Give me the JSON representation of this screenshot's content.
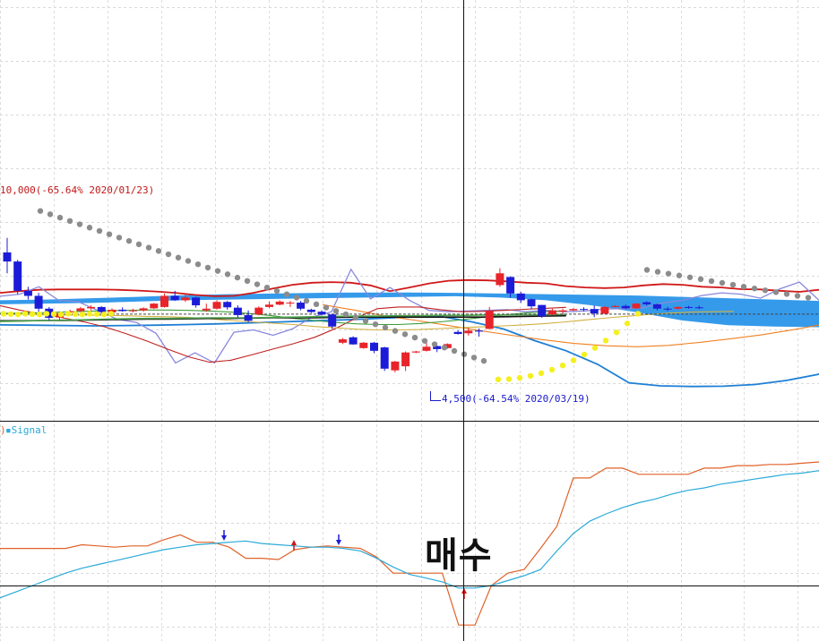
{
  "chart_data": [
    {
      "type": "candlestick",
      "pane": "price",
      "annotations": {
        "high": "10,000(-65.64% 2020/01/23)",
        "low": "4,500(-64.54% 2020/03/19)"
      },
      "colors": {
        "up": "#e8242a",
        "down": "#1c1cd8",
        "cloud": "#1f8fe8",
        "sar": "#8c8c8c",
        "sar_up": "#f4f020",
        "bollinger_upper": "#d01818",
        "bollinger_lower": "#1e7fd6",
        "lagging": "#8888dd"
      },
      "candles": [
        {
          "o": 8620,
          "h": 9050,
          "l": 8000,
          "c": 8350
        },
        {
          "o": 8350,
          "h": 8400,
          "l": 7380,
          "c": 7480
        },
        {
          "o": 7480,
          "h": 7600,
          "l": 7220,
          "c": 7330
        },
        {
          "o": 7330,
          "h": 7420,
          "l": 6800,
          "c": 6950
        },
        {
          "o": 6950,
          "h": 7000,
          "l": 6600,
          "c": 6680
        },
        {
          "o": 6690,
          "h": 6870,
          "l": 6600,
          "c": 6820
        },
        {
          "o": 6840,
          "h": 6920,
          "l": 6780,
          "c": 6870
        },
        {
          "o": 6880,
          "h": 7000,
          "l": 6850,
          "c": 6960
        },
        {
          "o": 6960,
          "h": 7050,
          "l": 6900,
          "c": 7000
        },
        {
          "o": 7000,
          "h": 7020,
          "l": 6800,
          "c": 6850
        },
        {
          "o": 6840,
          "h": 6960,
          "l": 6760,
          "c": 6920
        },
        {
          "o": 6920,
          "h": 6990,
          "l": 6860,
          "c": 6880
        },
        {
          "o": 6880,
          "h": 6950,
          "l": 6840,
          "c": 6900
        },
        {
          "o": 6900,
          "h": 6990,
          "l": 6860,
          "c": 6960
        },
        {
          "o": 6960,
          "h": 7120,
          "l": 6940,
          "c": 7100
        },
        {
          "o": 7000,
          "h": 7400,
          "l": 6980,
          "c": 7330
        },
        {
          "o": 7330,
          "h": 7480,
          "l": 7180,
          "c": 7200
        },
        {
          "o": 7200,
          "h": 7400,
          "l": 7150,
          "c": 7280
        },
        {
          "o": 7280,
          "h": 7300,
          "l": 6980,
          "c": 7050
        },
        {
          "o": 6900,
          "h": 7100,
          "l": 6860,
          "c": 6950
        },
        {
          "o": 6950,
          "h": 7200,
          "l": 6920,
          "c": 7150
        },
        {
          "o": 7150,
          "h": 7180,
          "l": 6920,
          "c": 6990
        },
        {
          "o": 6980,
          "h": 7050,
          "l": 6680,
          "c": 6760
        },
        {
          "o": 6760,
          "h": 6900,
          "l": 6550,
          "c": 6590
        },
        {
          "o": 6780,
          "h": 7020,
          "l": 6750,
          "c": 6980
        },
        {
          "o": 7000,
          "h": 7160,
          "l": 6960,
          "c": 7070
        },
        {
          "o": 7070,
          "h": 7200,
          "l": 7050,
          "c": 7160
        },
        {
          "o": 7110,
          "h": 7180,
          "l": 7000,
          "c": 7130
        },
        {
          "o": 7130,
          "h": 7180,
          "l": 6900,
          "c": 6950
        },
        {
          "o": 6920,
          "h": 6950,
          "l": 6820,
          "c": 6850
        },
        {
          "o": 6860,
          "h": 6900,
          "l": 6750,
          "c": 6780
        },
        {
          "o": 6780,
          "h": 6790,
          "l": 6350,
          "c": 6420
        },
        {
          "o": 5940,
          "h": 6080,
          "l": 5900,
          "c": 6040
        },
        {
          "o": 6100,
          "h": 6130,
          "l": 5880,
          "c": 5890
        },
        {
          "o": 5780,
          "h": 5960,
          "l": 5760,
          "c": 5940
        },
        {
          "o": 5940,
          "h": 5960,
          "l": 5630,
          "c": 5700
        },
        {
          "o": 5800,
          "h": 5820,
          "l": 5100,
          "c": 5170
        },
        {
          "o": 5120,
          "h": 5400,
          "l": 5060,
          "c": 5380
        },
        {
          "o": 5240,
          "h": 5680,
          "l": 5100,
          "c": 5650
        },
        {
          "o": 5650,
          "h": 5700,
          "l": 5630,
          "c": 5680
        },
        {
          "o": 5700,
          "h": 5950,
          "l": 5680,
          "c": 5820
        },
        {
          "o": 5840,
          "h": 5860,
          "l": 5660,
          "c": 5750
        },
        {
          "o": 5780,
          "h": 5920,
          "l": 5760,
          "c": 5900
        },
        {
          "o": 6260,
          "h": 6310,
          "l": 6180,
          "c": 6200
        },
        {
          "o": 6220,
          "h": 6380,
          "l": 6150,
          "c": 6300
        },
        {
          "o": 6300,
          "h": 6360,
          "l": 6120,
          "c": 6270
        },
        {
          "o": 6350,
          "h": 7000,
          "l": 6340,
          "c": 6890
        },
        {
          "o": 7650,
          "h": 8150,
          "l": 7600,
          "c": 8000
        },
        {
          "o": 7890,
          "h": 7910,
          "l": 7280,
          "c": 7400
        },
        {
          "o": 7400,
          "h": 7450,
          "l": 7120,
          "c": 7200
        },
        {
          "o": 7230,
          "h": 7250,
          "l": 6930,
          "c": 7020
        },
        {
          "o": 7060,
          "h": 7060,
          "l": 6680,
          "c": 6720
        },
        {
          "o": 6780,
          "h": 6950,
          "l": 6760,
          "c": 6900
        },
        {
          "o": 6860,
          "h": 6950,
          "l": 6800,
          "c": 6900
        },
        {
          "o": 6900,
          "h": 6960,
          "l": 6880,
          "c": 6940
        },
        {
          "o": 6940,
          "h": 6990,
          "l": 6870,
          "c": 6920
        },
        {
          "o": 6940,
          "h": 7050,
          "l": 6700,
          "c": 6810
        },
        {
          "o": 6800,
          "h": 7030,
          "l": 6790,
          "c": 7000
        },
        {
          "o": 7000,
          "h": 7060,
          "l": 6990,
          "c": 7030
        },
        {
          "o": 7030,
          "h": 7070,
          "l": 6940,
          "c": 6960
        },
        {
          "o": 6960,
          "h": 7120,
          "l": 6950,
          "c": 7100
        },
        {
          "o": 7140,
          "h": 7170,
          "l": 7040,
          "c": 7080
        },
        {
          "o": 7080,
          "h": 7100,
          "l": 6900,
          "c": 6950
        },
        {
          "o": 6950,
          "h": 7000,
          "l": 6880,
          "c": 6930
        },
        {
          "o": 6950,
          "h": 7020,
          "l": 6930,
          "c": 7000
        },
        {
          "o": 7000,
          "h": 7030,
          "l": 6950,
          "c": 6980
        },
        {
          "o": 6990,
          "h": 7040,
          "l": 6940,
          "c": 6970
        }
      ],
      "moving_averages": [
        {
          "color": "#f08020",
          "values": [
            7070,
            6910,
            6730,
            6600,
            6450,
            6300,
            6160,
            6030,
            5920,
            5850,
            5820,
            5860,
            5950,
            6060,
            6180,
            6330,
            6500,
            6650,
            6760,
            6830,
            6900
          ]
        },
        {
          "color": "#c02020",
          "values": [
            7040,
            6900,
            6790,
            6680,
            6560,
            6410,
            6210,
            5990,
            5750,
            5520,
            5360,
            5420,
            5580,
            5750,
            5910,
            6100,
            6360,
            6680,
            6950,
            7000,
            7000,
            6920,
            6860,
            6870,
            6900,
            6930,
            6960,
            6990
          ]
        },
        {
          "color": "#d0b040",
          "values": [
            6800,
            6790,
            6770,
            6760,
            6760,
            6750,
            6740,
            6720,
            6710,
            6690,
            6650,
            6600,
            6560,
            6520,
            6480,
            6420,
            6380,
            6340,
            6320,
            6320,
            6330,
            6360,
            6390,
            6410,
            6440,
            6470,
            6510,
            6560,
            6620,
            6680,
            6730,
            6780,
            6820,
            6850,
            6860,
            6870
          ]
        },
        {
          "color": "#3c9c3c",
          "values": [
            6810,
            6820,
            6830,
            6850,
            6870,
            6890,
            6900,
            6910,
            6910,
            6900,
            6880,
            6850,
            6800,
            6740,
            6660,
            6600,
            6540,
            6500,
            6480,
            6480,
            6510,
            6560,
            6620,
            6690,
            6760,
            6820,
            6860,
            6880
          ]
        },
        {
          "color": "#111111",
          "values": [
            6590,
            6590,
            6600,
            6600,
            6610,
            6620,
            6630,
            6640,
            6640,
            6650,
            6660,
            6660,
            6670,
            6680,
            6680,
            6680,
            6690,
            6700,
            6700,
            6700,
            6700,
            6700,
            6700,
            6700,
            6710,
            6720,
            6730,
            6740
          ]
        },
        {
          "color": "#4da34d",
          "values": [
            6570,
            6580,
            6600,
            6610,
            6620,
            6640,
            6650,
            6660,
            6660,
            6670,
            6680,
            6680,
            6680,
            6690,
            6700,
            6710,
            6720,
            6730,
            6730,
            6740,
            6740,
            6750,
            6750,
            6760,
            6760,
            6770,
            6770,
            6780
          ]
        }
      ],
      "bollinger": {
        "upper": [
          7420,
          7470,
          7510,
          7520,
          7520,
          7520,
          7510,
          7490,
          7460,
          7420,
          7360,
          7320,
          7330,
          7420,
          7550,
          7660,
          7720,
          7740,
          7720,
          7640,
          7470,
          7580,
          7700,
          7780,
          7800,
          7790,
          7760,
          7720,
          7700,
          7620,
          7580,
          7560,
          7580,
          7640,
          7680,
          7660,
          7600,
          7580,
          7530,
          7520,
          7480,
          7450,
          7510
        ],
        "lower": [
          6470,
          6460,
          6450,
          6440,
          6450,
          6460,
          6480,
          6500,
          6530,
          6560,
          6590,
          6620,
          6660,
          6700,
          6720,
          6560,
          6350,
          6000,
          5700,
          5300,
          4750,
          4660,
          4640,
          4650,
          4700,
          4820,
          5000,
          5270,
          5550,
          5880,
          6180,
          6400,
          6600
        ]
      },
      "cloud": [
        [
          7200,
          7080
        ],
        [
          7220,
          7100
        ],
        [
          7260,
          7120
        ],
        [
          7300,
          7160
        ],
        [
          7350,
          7200
        ],
        [
          7380,
          7220
        ],
        [
          7400,
          7240
        ],
        [
          7420,
          7260
        ],
        [
          7430,
          7280
        ],
        [
          7430,
          7300
        ],
        [
          7420,
          7320
        ],
        [
          7400,
          7280
        ],
        [
          7380,
          7200
        ],
        [
          7360,
          7050
        ],
        [
          7340,
          6840
        ],
        [
          7300,
          6600
        ],
        [
          7260,
          6460
        ],
        [
          7220,
          6420
        ],
        [
          7180,
          6400
        ]
      ],
      "lagging_span": [
        7320,
        7380,
        7600,
        7200,
        7160,
        6900,
        6640,
        6540,
        6220,
        5340,
        5640,
        5340,
        6250,
        6320,
        6160,
        6350,
        6700,
        6860,
        8120,
        7240,
        7580,
        7200,
        6900,
        6860,
        6880,
        6900,
        6920,
        6860,
        6900,
        6860,
        6880,
        6940,
        6950,
        6980,
        7120,
        7200,
        7340,
        7420,
        7380,
        7260,
        7540,
        7740,
        7200
      ]
    },
    {
      "type": "line",
      "pane": "indicator",
      "legend": "▪Signal",
      "series": [
        {
          "name": "",
          "color": "#e0622a",
          "values": [
            30,
            30,
            30,
            30,
            30,
            33,
            32,
            31,
            32,
            32,
            37,
            41,
            35,
            35,
            31,
            22,
            22,
            21,
            29,
            31,
            32,
            31,
            30,
            23,
            10,
            10,
            10,
            10,
            -32,
            -32,
            0,
            10,
            13,
            30,
            48,
            87,
            87,
            95,
            95,
            90,
            90,
            90,
            90,
            95,
            95,
            97,
            97,
            98,
            98,
            99,
            100
          ]
        },
        {
          "name": "Signal",
          "color": "#2aaad8",
          "values": [
            -10,
            -5,
            0,
            5,
            10,
            14,
            17,
            20,
            23,
            26,
            29,
            31,
            33,
            34,
            35,
            36,
            34,
            33,
            32,
            31,
            31,
            30,
            28,
            22,
            15,
            9,
            6,
            3,
            -2,
            -2,
            0,
            4,
            8,
            13,
            28,
            42,
            52,
            58,
            63,
            67,
            70,
            74,
            77,
            79,
            82,
            84,
            86,
            88,
            90,
            91,
            93
          ]
        }
      ],
      "signals": [
        {
          "type": "sell",
          "color": "#1c1cd8"
        },
        {
          "type": "buy",
          "color": "#d01818"
        },
        {
          "type": "sell",
          "color": "#1c1cd8"
        },
        {
          "type": "buy",
          "color": "#d01818"
        }
      ]
    }
  ],
  "buy_label": "매수"
}
